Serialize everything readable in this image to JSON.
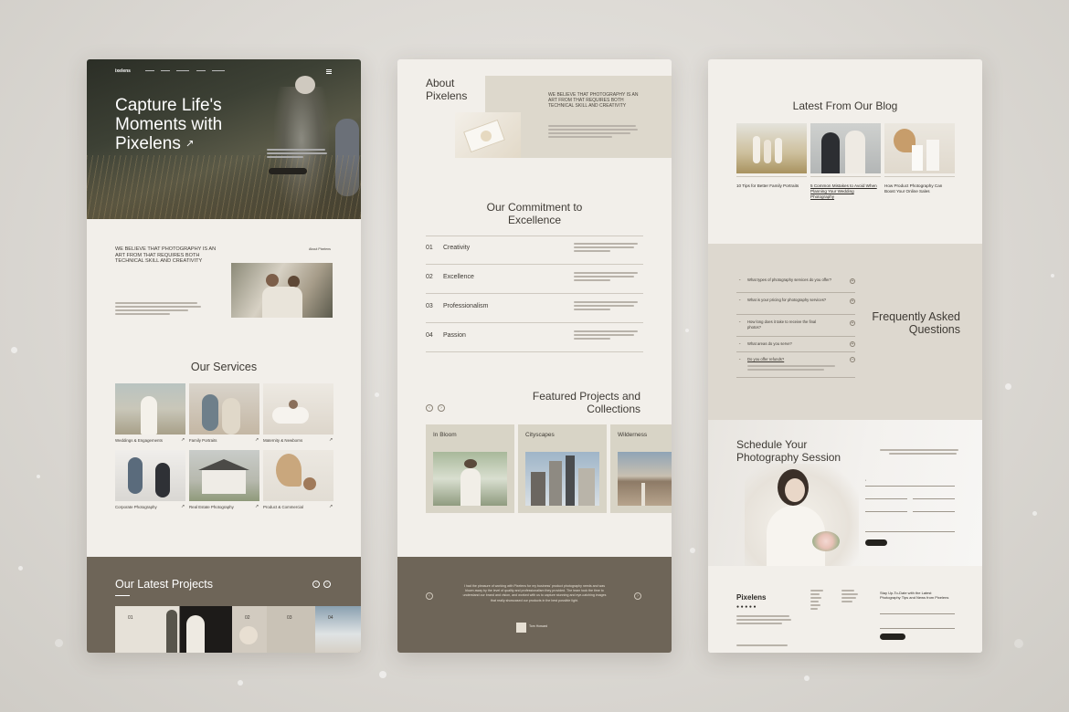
{
  "colors": {
    "background": "#dcd9d4",
    "panel": "#f2efea",
    "accent_brown": "#6e6558",
    "accent_beige": "#ddd8cf",
    "text_dark": "#3e3a34"
  },
  "panel1": {
    "nav": {
      "logo": "ixelens",
      "items": [
        "",
        "",
        "",
        "",
        ""
      ],
      "menu_icon": "hamburger-icon"
    },
    "hero": {
      "title_line1": "Capture Life's",
      "title_line2": "Moments with",
      "title_line3": "Pixelens",
      "arrow_icon": "arrow-up-right-icon"
    },
    "about": {
      "statement": "WE BELIEVE THAT PHOTOGRAPHY IS AN ART FROM THAT REQUIRES BOTH TECHNICAL SKILL AND CREATIVITY",
      "link": "About Pixelens"
    },
    "services": {
      "title": "Our Services",
      "items": [
        {
          "label": "Weddings & Engagements"
        },
        {
          "label": "Family Portraits"
        },
        {
          "label": "Maternity & Newborns"
        },
        {
          "label": "Corporate Photography"
        },
        {
          "label": "Real Estate Photography"
        },
        {
          "label": "Product & Commercial"
        }
      ]
    },
    "latest": {
      "title": "Our Latest Projects",
      "numbers": [
        "01",
        "02",
        "03",
        "04"
      ]
    }
  },
  "panel2": {
    "about": {
      "title_line1": "About",
      "title_line2": "Pixelens",
      "statement": "WE BELIEVE THAT PHOTOGRAPHY IS AN ART FROM THAT REQUIRES BOTH TECHNICAL SKILL AND CREATIVITY"
    },
    "commitment": {
      "title_line1": "Our Commitment to",
      "title_line2": "Excellence",
      "items": [
        {
          "num": "01",
          "name": "Creativity"
        },
        {
          "num": "02",
          "name": "Excellence"
        },
        {
          "num": "03",
          "name": "Professionalism"
        },
        {
          "num": "04",
          "name": "Passion"
        }
      ]
    },
    "featured": {
      "title_line1": "Featured Projects and",
      "title_line2": "Collections",
      "cards": [
        {
          "label": "In Bloom"
        },
        {
          "label": "Cityscapes"
        },
        {
          "label": "Wilderness"
        }
      ]
    },
    "testimonial": {
      "quote": "I had the pleasure of working with Pixelens for my business' product photography needs and was blown away by the level of quality and professionalism they provided. The team took the time to understand our brand and vision, and worked with us to capture stunning and eye-catching images that really showcased our products in the best possible light.",
      "name": "Tom Howard"
    }
  },
  "panel3": {
    "blog": {
      "title": "Latest From Our Blog",
      "posts": [
        {
          "title": "10 Tips for Better Family Portraits"
        },
        {
          "title": "5 Common Mistakes to Avoid When Planning Your Wedding Photography"
        },
        {
          "title": "How Product Photography Can Boost Your Online Sales"
        }
      ]
    },
    "faq": {
      "title_line1": "Frequently Asked",
      "title_line2": "Questions",
      "items": [
        {
          "q": "What types of photography services do you offer?"
        },
        {
          "q": "What is your pricing for photography services?"
        },
        {
          "q": "How long does it take to receive the final photos?"
        },
        {
          "q": "What areas do you serve?"
        },
        {
          "q": "Do you offer refunds?"
        }
      ]
    },
    "schedule": {
      "title_line1": "Schedule Your",
      "title_line2": "Photography Session"
    },
    "footer": {
      "logo": "Pixelens",
      "newsletter_line1": "Stay Up-To-Date with the Latest",
      "newsletter_line2": "Photography Tips and News from Pixelens"
    }
  }
}
